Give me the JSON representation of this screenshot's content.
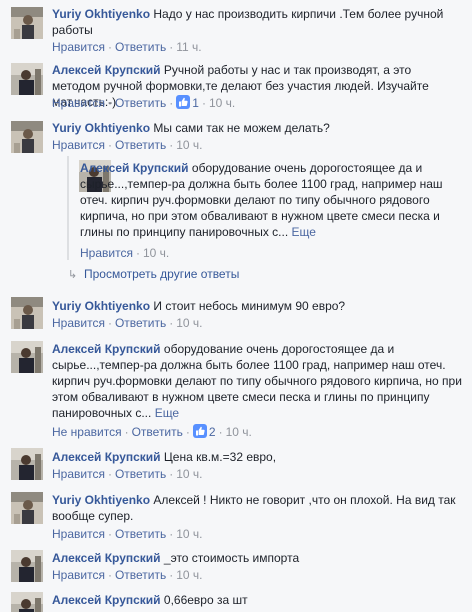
{
  "comments": [
    {
      "author": "Yuriy Okhtiyenko",
      "text": "Надо у нас производить кирпичи .Тем более ручной работы",
      "like_label": "Нравится",
      "reply_label": "Ответить",
      "time": "11 ч."
    },
    {
      "author": "Алексей Крупский",
      "text": "Ручной работы у нас и так производят, а это методом ручной формовки,те делают без участия людей. Изучайте мат.часть:-)",
      "like_label": "Нравится",
      "reply_label": "Ответить",
      "likes_count": "1",
      "time": "10 ч."
    },
    {
      "author": "Yuriy Okhtiyenko",
      "text": "Мы сами так не можем делать?",
      "like_label": "Нравится",
      "reply_label": "Ответить",
      "time": "10 ч."
    },
    {
      "author": "Алексей Крупский",
      "text": "оборудование очень дорогостоящее да и сырье...,темпер-ра должна быть более 1100 град, например наш отеч. кирпич руч.формовки делают по типу обычного рядового кирпича, но при этом обваливают в нужном цвете смеси песка и глины по принципу панировочных с...",
      "more_label": "Еще",
      "like_label": "Нравится",
      "time": "10 ч."
    },
    {
      "author": "Yuriy Okhtiyenko",
      "text": "И стоит небось минимум 90 евро?",
      "like_label": "Нравится",
      "reply_label": "Ответить",
      "time": "10 ч."
    },
    {
      "author": "Алексей Крупский",
      "text": "оборудование очень дорогостоящее да и сырье...,темпер-ра должна быть более 1100 град, например наш отеч. кирпич руч.формовки делают по типу обычного рядового кирпича, но при этом обваливают в нужном цвете смеси песка и глины по принципу панировочных с...",
      "more_label": "Еще",
      "like_label": "Не нравится",
      "reply_label": "Ответить",
      "likes_count": "2",
      "time": "10 ч."
    },
    {
      "author": "Алексей Крупский",
      "text": "Цена кв.м.=32 евро,",
      "like_label": "Нравится",
      "reply_label": "Ответить",
      "time": "10 ч."
    },
    {
      "author": "Yuriy Okhtiyenko",
      "text": "Алексей ! Никто не говорит ,что он плохой. На вид так вообще супер.",
      "like_label": "Нравится",
      "reply_label": "Ответить",
      "time": "10 ч."
    },
    {
      "author": "Алексей Крупский",
      "text": "_это стоимость импорта",
      "like_label": "Нравится",
      "reply_label": "Ответить",
      "time": "10 ч."
    },
    {
      "author": "Алексей Крупский",
      "text": "0,66евро за шт"
    }
  ],
  "view_more_replies": "Просмотреть другие ответы",
  "separator": "·",
  "icons": {
    "like": "thumbs-up-icon",
    "view_more": "reply-arrow-icon"
  },
  "colors": {
    "link": "#365899",
    "action": "#4b67a1",
    "meta": "#90949c",
    "background": "#f6f7f9"
  }
}
